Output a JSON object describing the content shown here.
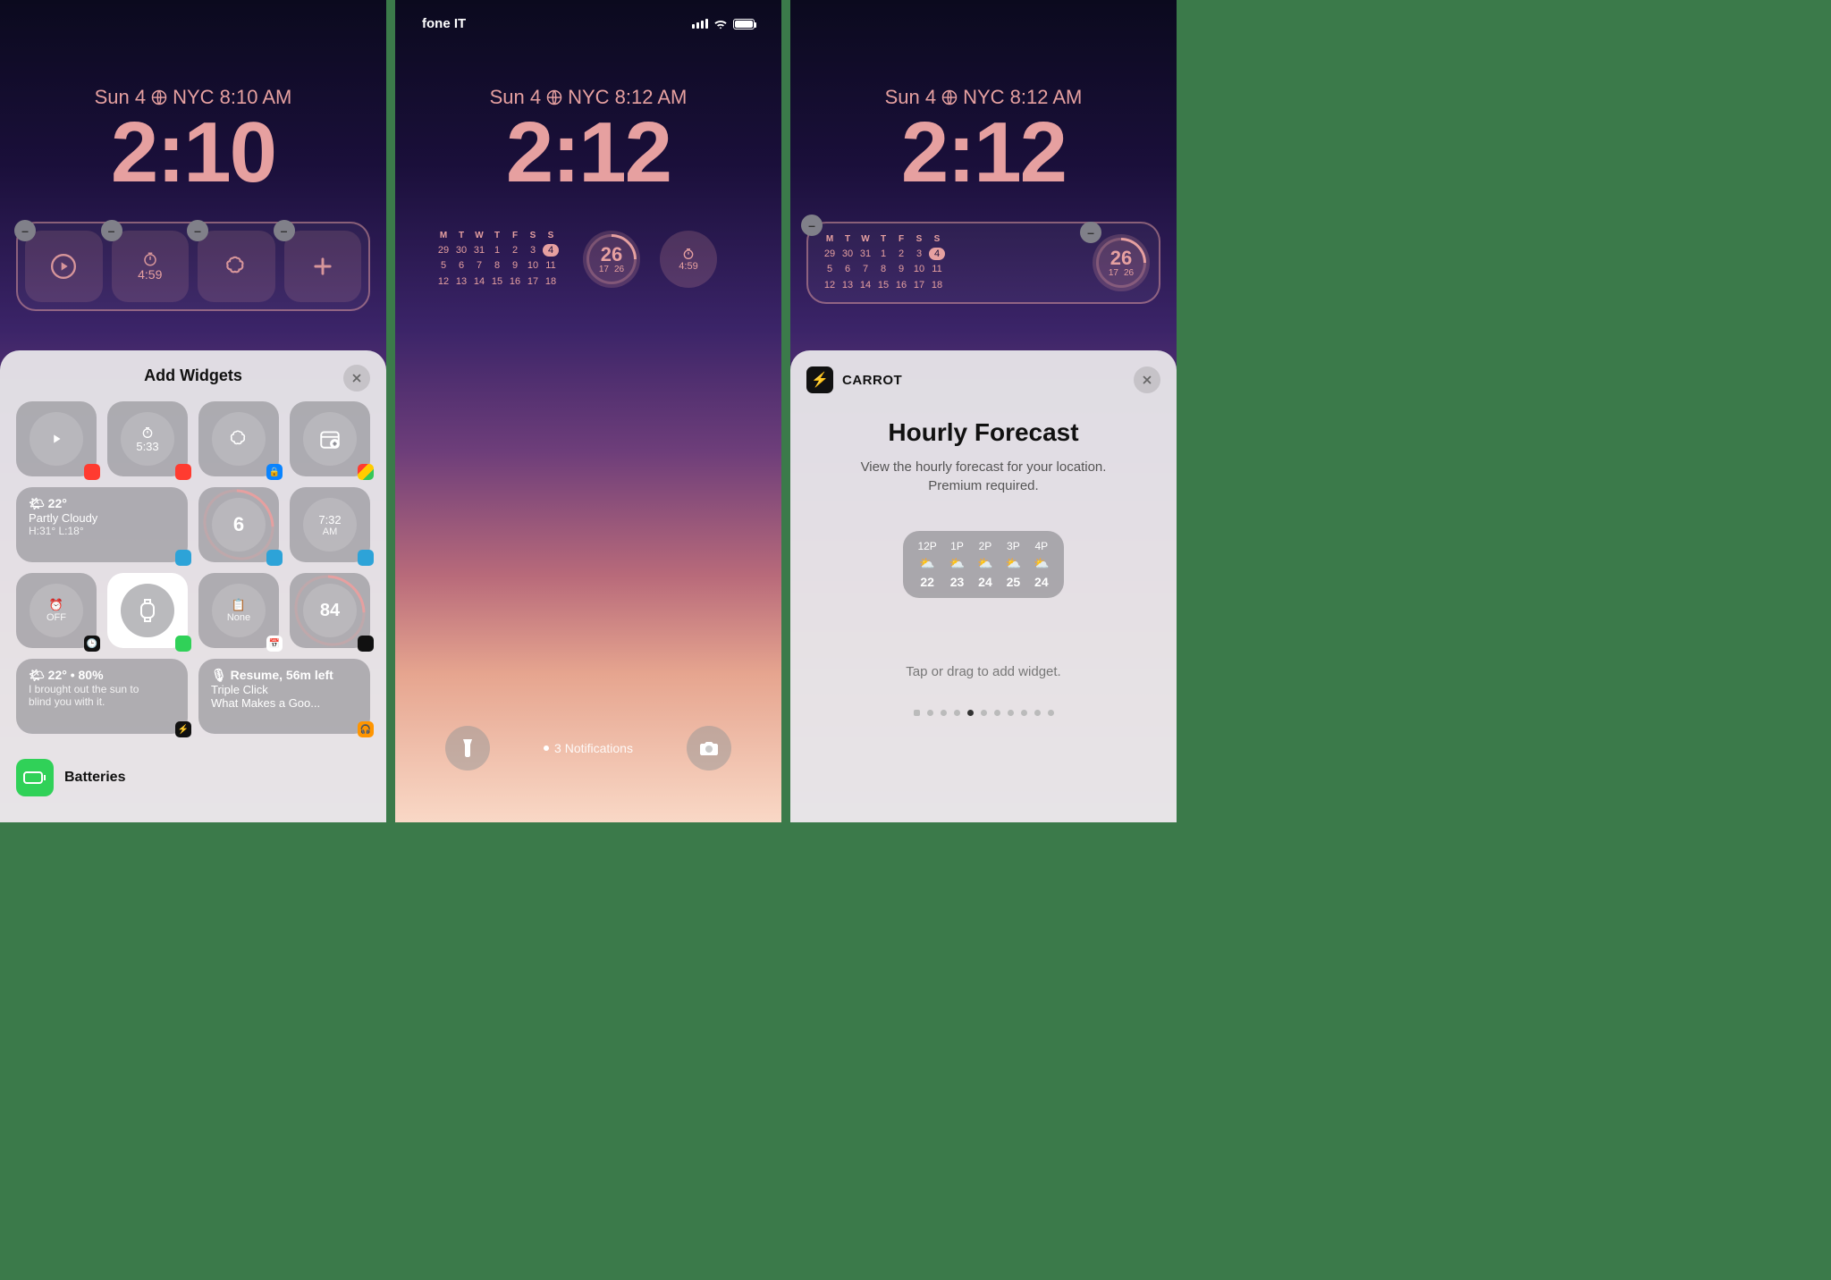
{
  "panels": {
    "p1": {
      "date": "Sun 4",
      "city_time": "NYC 8:10 AM",
      "clock": "2:10",
      "widgets": [
        {
          "name": "play",
          "label": ""
        },
        {
          "name": "timer",
          "label": "4:59"
        },
        {
          "name": "mindfulness",
          "label": ""
        },
        {
          "name": "add",
          "label": ""
        }
      ],
      "sheet": {
        "title": "Add Widgets",
        "suggestions": [
          {
            "name": "play",
            "text": "",
            "badge": "red",
            "circle": true
          },
          {
            "name": "timer",
            "text": "5:33",
            "badge": "red",
            "circle": true
          },
          {
            "name": "mindfulness",
            "text": "",
            "badge": "dkblue",
            "circle": true
          },
          {
            "name": "calendar-add",
            "text": "",
            "badge": "multicolor",
            "circle": true
          },
          {
            "name": "weather-wide",
            "span": 2,
            "line1": "🌤 22°",
            "line2": "Partly Cloudy",
            "line3": "H:31° L:18°",
            "badge": "blue"
          },
          {
            "name": "uv",
            "text": "6",
            "badge": "blue",
            "circle": true,
            "ring": true
          },
          {
            "name": "sunrise",
            "line1": "7:32",
            "line2": "AM",
            "badge": "blue",
            "circle": true
          },
          {
            "name": "alarm",
            "line1": "⏰",
            "line2": "OFF",
            "badge": "black",
            "circle": true
          },
          {
            "name": "watch",
            "text": "",
            "badge": "green",
            "circle": true,
            "bigcircle": true
          },
          {
            "name": "reminders",
            "line1": "📋",
            "line2": "None",
            "badge": "white",
            "circle": true
          },
          {
            "name": "battery",
            "text": "84",
            "badge": "black",
            "circle": true,
            "ring": true
          },
          {
            "name": "carrot-wide",
            "span": 2,
            "line1": "🌤 22° • 80%",
            "line2": "I brought out the sun to",
            "line3": "blind you with it.",
            "badge": "black"
          },
          {
            "name": "podcast-wide",
            "span": 2,
            "line1": "🎙 Resume, 56m left",
            "line2": "Triple Click",
            "line3": "What Makes a Goo...",
            "badge": "orange"
          }
        ],
        "list_first": "Batteries"
      }
    },
    "p2": {
      "status_carrier": "fone IT",
      "date": "Sun 4",
      "city_time": "NYC 8:12 AM",
      "clock": "2:12",
      "calendar": {
        "days": [
          "M",
          "T",
          "W",
          "T",
          "F",
          "S",
          "S"
        ],
        "rows": [
          [
            "29",
            "30",
            "31",
            "1",
            "2",
            "3",
            "4"
          ],
          [
            "5",
            "6",
            "7",
            "8",
            "9",
            "10",
            "11"
          ],
          [
            "12",
            "13",
            "14",
            "15",
            "16",
            "17",
            "18"
          ]
        ],
        "today_col": 6,
        "today_row": 0,
        "today_val": "4"
      },
      "ring_widget": {
        "main": "26",
        "sub_left": "17",
        "sub_right": "26"
      },
      "timer_widget": {
        "label": "4:59"
      },
      "notifications": "3 Notifications"
    },
    "p3": {
      "date": "Sun 4",
      "city_time": "NYC 8:12 AM",
      "clock": "2:12",
      "calendar": {
        "days": [
          "M",
          "T",
          "W",
          "T",
          "F",
          "S",
          "S"
        ],
        "rows": [
          [
            "29",
            "30",
            "31",
            "1",
            "2",
            "3",
            "4"
          ],
          [
            "5",
            "6",
            "7",
            "8",
            "9",
            "10",
            "11"
          ],
          [
            "12",
            "13",
            "14",
            "15",
            "16",
            "17",
            "18"
          ]
        ],
        "today_col": 6,
        "today_row": 0,
        "today_val": "4"
      },
      "ring_widget": {
        "main": "26",
        "sub_left": "17",
        "sub_right": "26"
      },
      "sheet": {
        "app_name": "CARROT",
        "title": "Hourly Forecast",
        "desc": "View the hourly forecast for your location. Premium required.",
        "forecast": [
          {
            "hr": "12P",
            "temp": "22"
          },
          {
            "hr": "1P",
            "temp": "23"
          },
          {
            "hr": "2P",
            "temp": "24"
          },
          {
            "hr": "3P",
            "temp": "25"
          },
          {
            "hr": "4P",
            "temp": "24"
          }
        ],
        "hint": "Tap or drag to add widget.",
        "page_index": 4,
        "page_count": 11
      }
    }
  }
}
